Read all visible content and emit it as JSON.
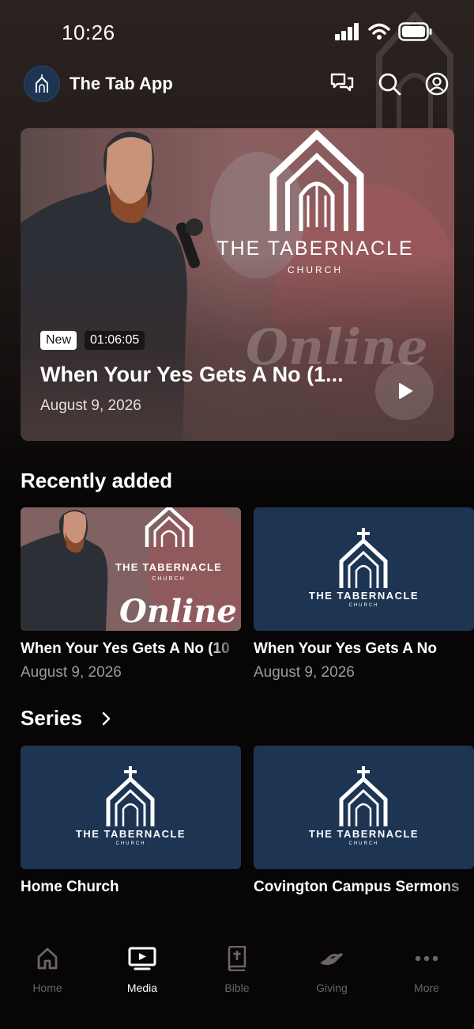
{
  "status_bar": {
    "time": "10:26"
  },
  "header": {
    "title": "The Tab App",
    "logo_icon": "church-logo-icon",
    "actions": [
      "chat-icon",
      "search-icon",
      "profile-icon"
    ]
  },
  "hero": {
    "badge": "New",
    "duration": "01:06:05",
    "title": "When Your Yes Gets A No (1...",
    "date": "August 9, 2026",
    "brand_line1": "THE TABERNACLE",
    "brand_line2": "CHURCH",
    "script_text": "Online"
  },
  "recently_added": {
    "title": "Recently added",
    "items": [
      {
        "title": "When Your Yes Gets A No (10",
        "date": "August 9, 2026",
        "brand": "THE TABERNACLE",
        "sub": "CHURCH",
        "script": "Online"
      },
      {
        "title": "When Your Yes Gets A No",
        "date": "August 9, 2026",
        "brand": "THE TABERNACLE",
        "sub": "CHURCH"
      }
    ]
  },
  "series": {
    "title": "Series",
    "items": [
      {
        "title": "Home Church",
        "brand": "THE TABERNACLE",
        "sub": "CHURCH"
      },
      {
        "title": "Covington Campus Sermons",
        "brand": "THE TABERNACLE",
        "sub": "CHURCH"
      }
    ]
  },
  "bottom_nav": [
    {
      "label": "Home",
      "icon": "home-icon",
      "active": false
    },
    {
      "label": "Media",
      "icon": "tv-icon",
      "active": true
    },
    {
      "label": "Bible",
      "icon": "bible-icon",
      "active": false
    },
    {
      "label": "Giving",
      "icon": "giving-hand-icon",
      "active": false
    },
    {
      "label": "More",
      "icon": "more-icon",
      "active": false
    }
  ],
  "colors": {
    "brand_navy": "#1d3453",
    "background": "#070505",
    "hero_tint": "#6d5856"
  }
}
